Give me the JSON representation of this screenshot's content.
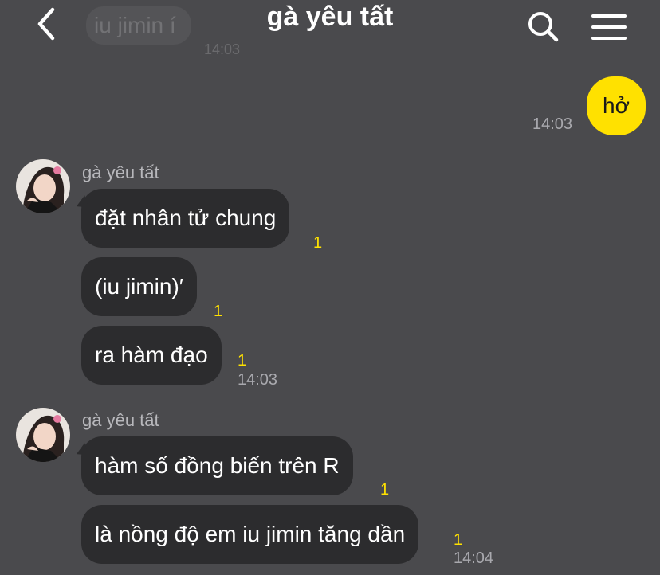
{
  "header": {
    "title": "gà yêu tất",
    "ghost_message": "iu jimin í",
    "ghost_time": "14:03",
    "back_icon": "chevron-left-icon",
    "search_icon": "search-icon",
    "menu_icon": "hamburger-menu-icon"
  },
  "messages": {
    "outgoing_1": {
      "text": "hở",
      "time": "14:03"
    },
    "group_1": {
      "sender": "gà yêu tất",
      "items": [
        {
          "text": "đặt nhân tử chung",
          "unread": "1"
        },
        {
          "text": "(iu jimin)′",
          "unread": "1"
        },
        {
          "text": "ra hàm đạo",
          "unread": "1"
        }
      ],
      "time": "14:03"
    },
    "group_2": {
      "sender": "gà yêu tất",
      "items": [
        {
          "text": "hàm số đồng biến trên R",
          "unread": "1"
        },
        {
          "text": "là nồng độ em iu jimin tăng dần",
          "unread": "1"
        }
      ],
      "time": "14:04"
    }
  },
  "colors": {
    "background": "#4a4a4d",
    "incoming_bubble": "#2c2c2e",
    "outgoing_bubble": "#ffe100",
    "unread_count": "#ffe100"
  }
}
